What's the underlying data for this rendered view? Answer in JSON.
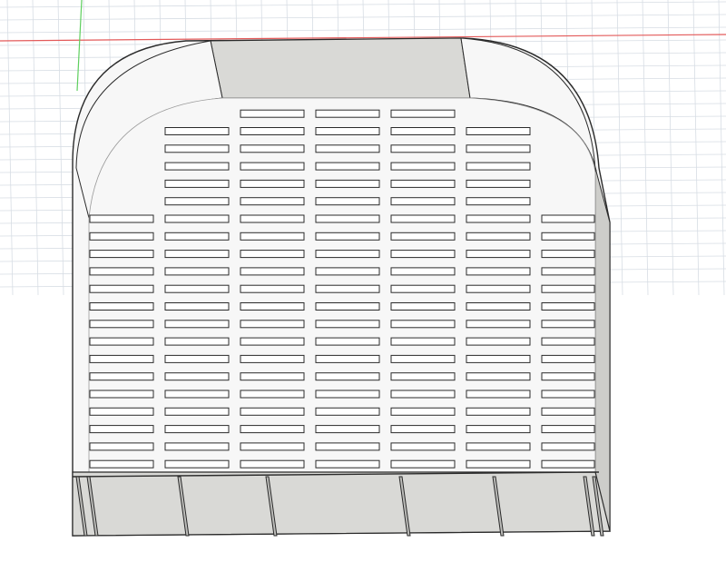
{
  "viewport": {
    "background": "#ffffff",
    "grid_color": "#d7dde4",
    "x_axis_color": "#e35a5a",
    "y_axis_color": "#5ecf5e"
  },
  "model": {
    "name": "drawer-insert-tray",
    "surface_color": "#f7f7f7",
    "wall_color": "#d9d9d6",
    "shadow_color": "#cdcdca",
    "edge_color": "#2b2b2b",
    "slot": {
      "columns": 7,
      "rows": 20,
      "fill": "#ffffff"
    }
  }
}
